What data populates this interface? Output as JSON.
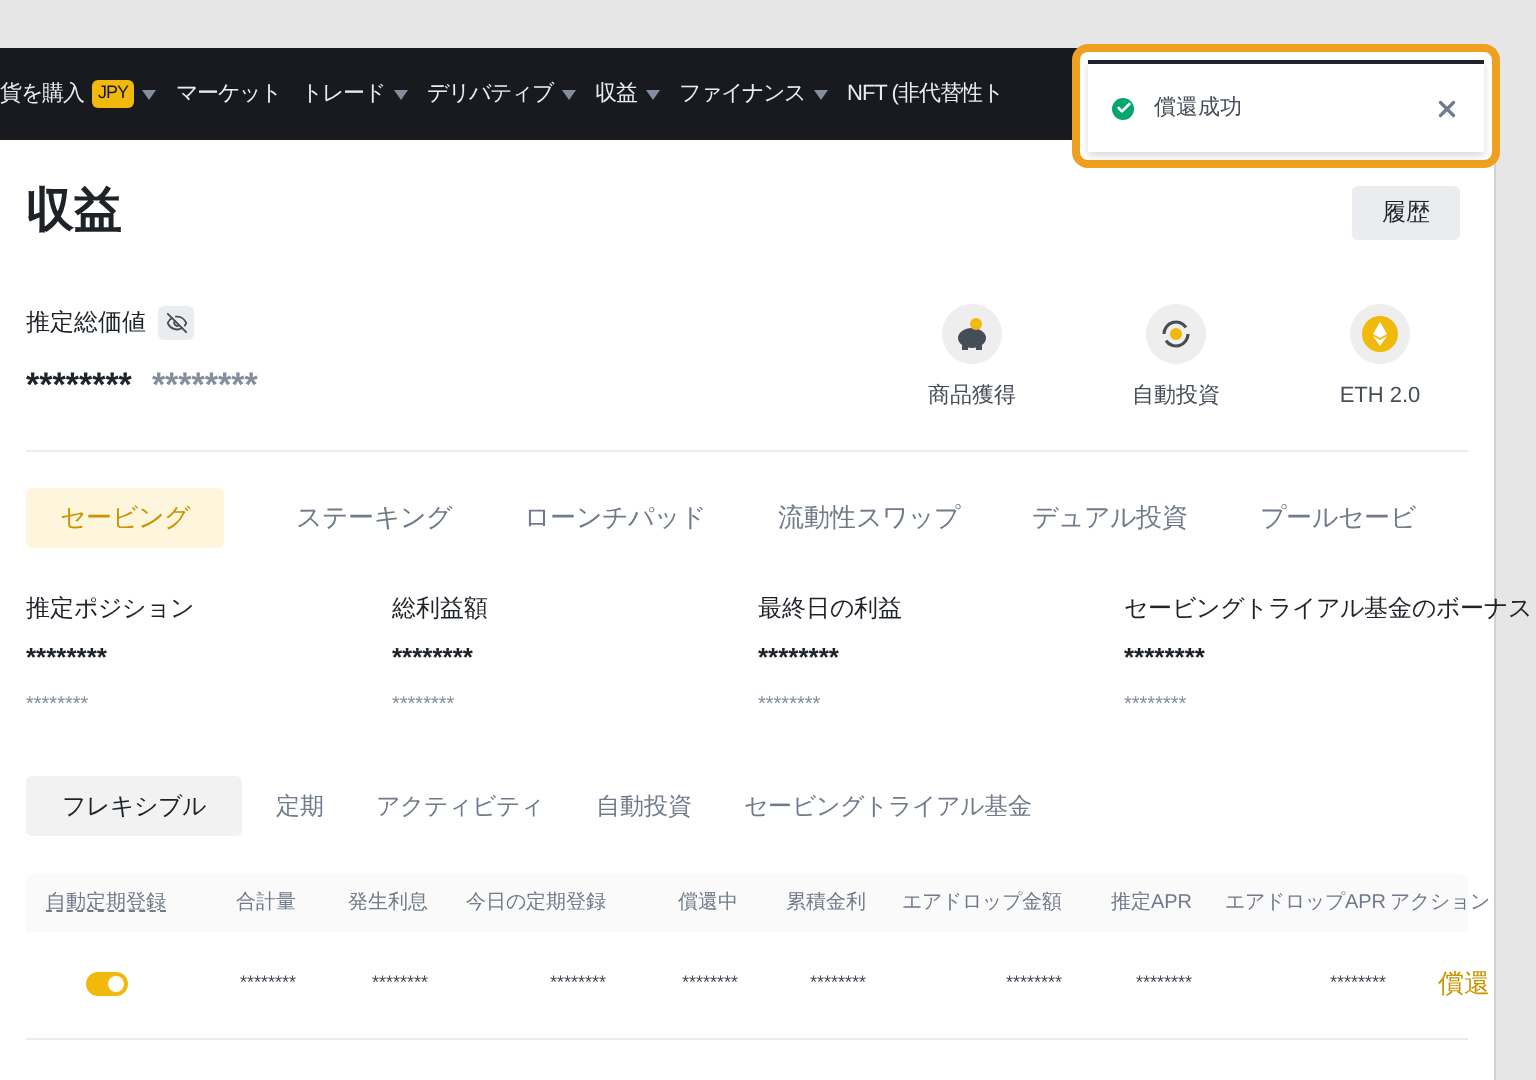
{
  "nav": {
    "items": [
      {
        "label": "貨を購入",
        "badge": "JPY",
        "dropdown": true
      },
      {
        "label": "マーケット",
        "dropdown": false
      },
      {
        "label": "トレード",
        "dropdown": true
      },
      {
        "label": "デリバティブ",
        "dropdown": true
      },
      {
        "label": "収益",
        "dropdown": true
      },
      {
        "label": "ファイナンス",
        "dropdown": true
      },
      {
        "label": "NFT (非代替性ト",
        "dropdown": false
      }
    ]
  },
  "toast": {
    "kind": "success",
    "message": "償還成功"
  },
  "page": {
    "title": "収益",
    "history_button": "履歴"
  },
  "summary": {
    "label": "推定総価値",
    "value": "********",
    "secondary": "********",
    "shortcuts": [
      {
        "kind": "piggy",
        "label": "商品獲得"
      },
      {
        "kind": "auto",
        "label": "自動投資"
      },
      {
        "kind": "eth",
        "label": "ETH 2.0"
      }
    ]
  },
  "tabs": [
    {
      "label": "セービング",
      "selected": true
    },
    {
      "label": "ステーキング",
      "selected": false
    },
    {
      "label": "ローンチパッド",
      "selected": false
    },
    {
      "label": "流動性スワップ",
      "selected": false
    },
    {
      "label": "デュアル投資",
      "selected": false
    },
    {
      "label": "プールセービ",
      "selected": false
    }
  ],
  "stats": [
    {
      "label": "推定ポジション",
      "value": "********",
      "secondary": "********"
    },
    {
      "label": "総利益額",
      "value": "********",
      "secondary": "********"
    },
    {
      "label": "最終日の利益",
      "value": "********",
      "secondary": "********"
    },
    {
      "label": "セービングトライアル基金のボーナス",
      "value": "********",
      "secondary": "********"
    }
  ],
  "subtabs": [
    {
      "label": "フレキシブル",
      "selected": true
    },
    {
      "label": "定期",
      "selected": false
    },
    {
      "label": "アクティビティ",
      "selected": false
    },
    {
      "label": "自動投資",
      "selected": false
    },
    {
      "label": "セービングトライアル基金",
      "selected": false
    }
  ],
  "table": {
    "columns": [
      "自動定期登録",
      "合計量",
      "発生利息",
      "今日の定期登録",
      "償還中",
      "累積金利",
      "エアドロップ金額",
      "推定APR",
      "エアドロップAPR",
      "アクション"
    ],
    "rows": [
      {
        "auto_subscribe": true,
        "values": [
          "********",
          "********",
          "********",
          "********",
          "********",
          "********",
          "********",
          "********"
        ],
        "action": "償還"
      }
    ]
  }
}
